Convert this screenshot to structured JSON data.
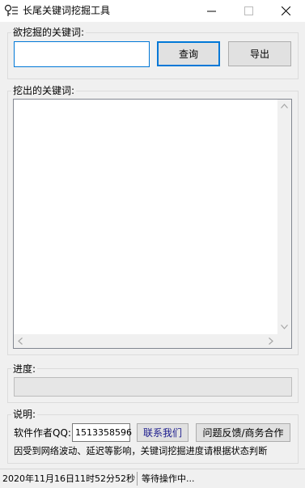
{
  "window": {
    "title": "长尾关键词挖掘工具"
  },
  "search": {
    "group_label": "欲挖掘的关键词:",
    "input_value": "",
    "query_button": "查询",
    "export_button": "导出"
  },
  "results": {
    "group_label": "挖出的关键词:",
    "items": []
  },
  "progress": {
    "group_label": "进度:",
    "value": 0
  },
  "info": {
    "group_label": "说明:",
    "author_qq_label": "软件作者QQ:",
    "author_qq_value": "1513358596",
    "contact_button": "联系我们",
    "feedback_button": "问题反馈/商务合作",
    "notice": "因受到网络波动、延迟等影响，关键词挖掘进度请根据状态判断"
  },
  "status": {
    "datetime": "2020年11月16日11时52分52秒",
    "message": "等待操作中..."
  },
  "colors": {
    "accent": "#0078d7",
    "window_bg": "#f0f0f0",
    "contact_text": "#1a1a8c"
  }
}
